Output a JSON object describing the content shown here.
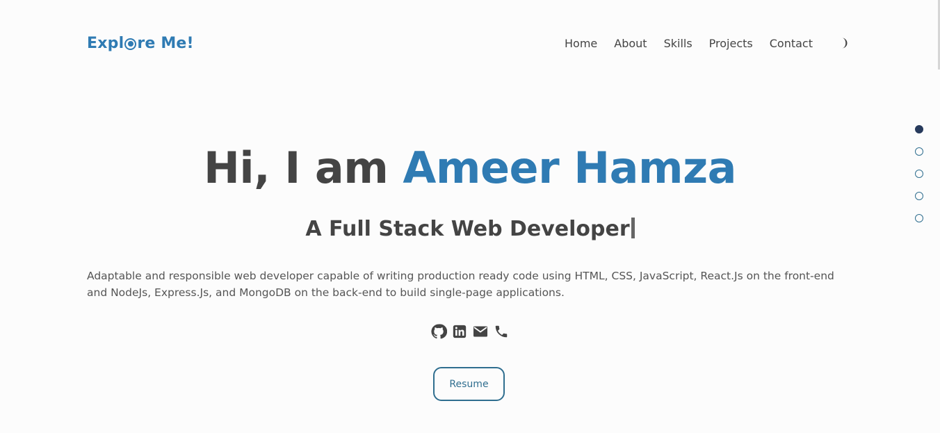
{
  "logo": {
    "text_before": "Expl",
    "text_after": "re Me!"
  },
  "nav": {
    "items": [
      "Home",
      "About",
      "Skills",
      "Projects",
      "Contact"
    ]
  },
  "hero": {
    "greeting": "Hi, I am ",
    "name": "Ameer Hamza",
    "subtitle": "A Full Stack Web Developer",
    "description": "Adaptable and responsible web developer capable of writing production ready code using HTML, CSS, JavaScript, React.Js on the front-end and NodeJs, Express.Js, and MongoDB on the back-end to build single-page applications."
  },
  "socials": [
    "github-icon",
    "linkedin-icon",
    "mail-icon",
    "phone-icon"
  ],
  "resume_label": "Resume",
  "colors": {
    "accent": "#2f7bb3",
    "text": "#444444",
    "dot_active": "#273a5c"
  }
}
